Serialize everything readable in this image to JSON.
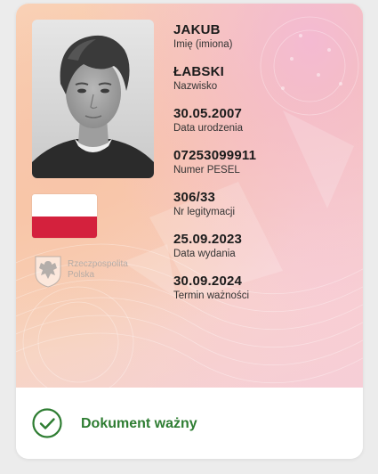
{
  "document": {
    "fields": [
      {
        "value": "JAKUB",
        "label": "Imię (imiona)"
      },
      {
        "value": "ŁABSKI",
        "label": "Nazwisko"
      },
      {
        "value": "30.05.2007",
        "label": "Data urodzenia"
      },
      {
        "value": "07253099911",
        "label": "Numer PESEL"
      },
      {
        "value": "306/33",
        "label": "Nr legitymacji"
      },
      {
        "value": "25.09.2023",
        "label": "Data wydania"
      },
      {
        "value": "30.09.2024",
        "label": "Termin ważności"
      }
    ],
    "emblem_text_line1": "Rzeczpospolita",
    "emblem_text_line2": "Polska",
    "flag_colors": {
      "top": "#ffffff",
      "bottom": "#d4213d"
    }
  },
  "status": {
    "text": "Dokument ważny",
    "color": "#2e7d32",
    "icon": "check-circle-icon"
  }
}
